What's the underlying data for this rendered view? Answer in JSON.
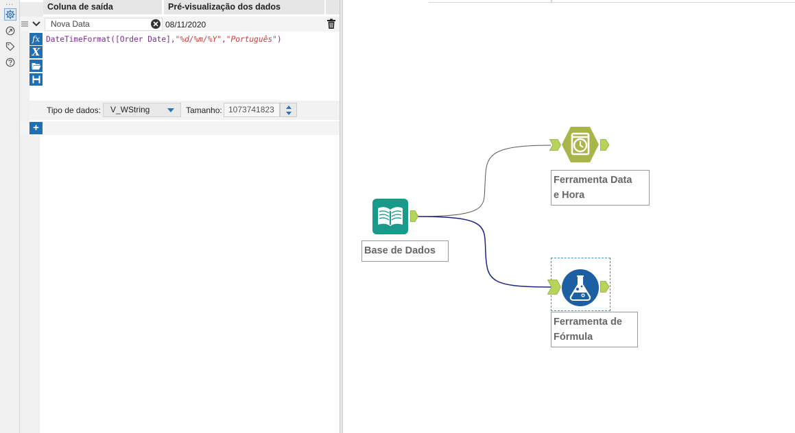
{
  "toolbar": {
    "buttons": [
      {
        "name": "configuration",
        "icon": "gear-icon"
      },
      {
        "name": "connections",
        "icon": "arrow-circle-icon"
      },
      {
        "name": "annotation",
        "icon": "tag-icon"
      },
      {
        "name": "help",
        "icon": "question-icon"
      }
    ]
  },
  "grid": {
    "headers": {
      "output_column": "Coluna de saída",
      "data_preview": "Pré-visualização dos dados"
    },
    "row": {
      "output_column": "Nova Data",
      "preview": "08/11/2020",
      "expression": {
        "function": "DateTimeFormat",
        "field": "[Order Date]",
        "format": "\"%d/%m/%Y\"",
        "language": "\"Português\""
      }
    },
    "data_type": {
      "label": "Tipo de dados:",
      "value": "V_WString"
    },
    "size": {
      "label": "Tamanho:",
      "value": "1073741823"
    }
  },
  "canvas": {
    "nodes": [
      {
        "id": "input",
        "label_line1": "Base de Dados",
        "label_line2": "",
        "icon": "book-icon",
        "color": "#1a9a8a"
      },
      {
        "id": "datetime",
        "label_line1": "Ferramenta Data",
        "label_line2": "e Hora",
        "icon": "clock-icon",
        "color": "#a7b54a"
      },
      {
        "id": "formula",
        "label_line1": "Ferramenta de",
        "label_line2": "Fórmula",
        "icon": "flask-icon",
        "color": "#1d5fa3"
      }
    ],
    "colors": {
      "anchor": "#b6d45c",
      "connection_plain": "#555555",
      "connection_selected": "#1a237e"
    }
  }
}
